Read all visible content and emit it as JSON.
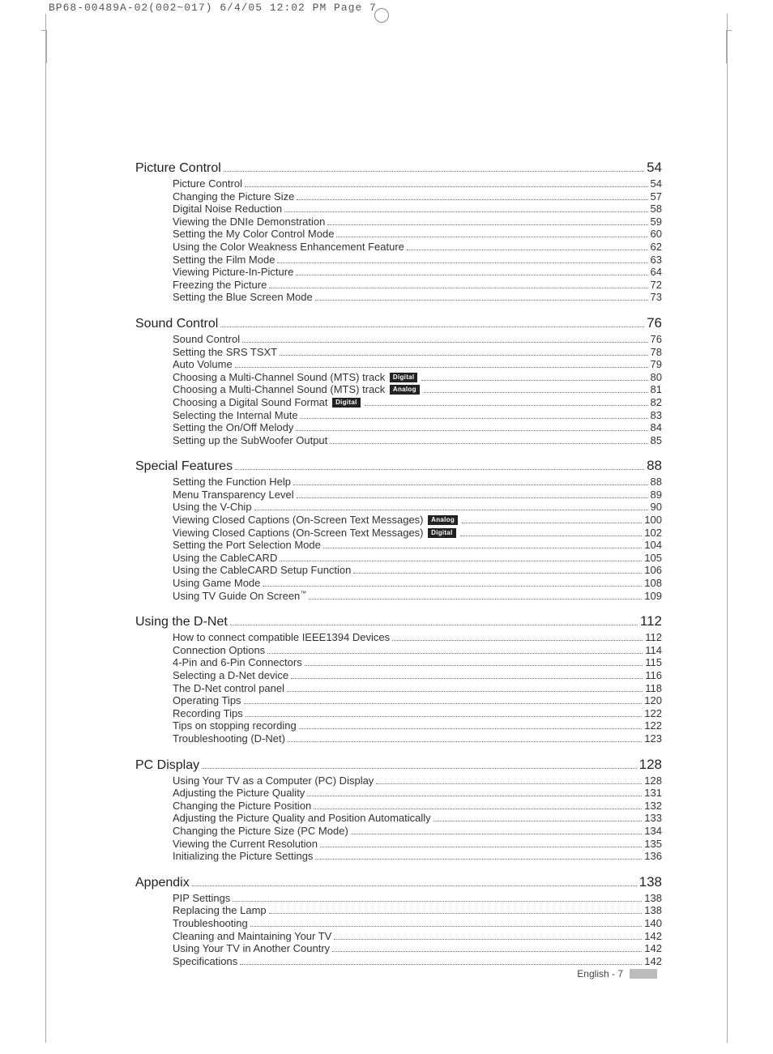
{
  "print_slug": "BP68-00489A-02(002~017)  6/4/05  12:02 PM  Page 7",
  "footer": "English - 7",
  "badges": {
    "digital": "Digital",
    "analog": "Analog"
  },
  "sections": [
    {
      "title": "Picture Control",
      "page": "54",
      "entries": [
        {
          "label": "Picture Control",
          "page": "54"
        },
        {
          "label": "Changing the Picture Size",
          "page": "57"
        },
        {
          "label": "Digital Noise Reduction",
          "page": "58"
        },
        {
          "label": "Viewing the DNIe Demonstration",
          "page": "59"
        },
        {
          "label": "Setting the My Color Control Mode",
          "page": "60"
        },
        {
          "label": "Using the Color Weakness Enhancement Feature",
          "page": "62"
        },
        {
          "label": "Setting the Film Mode",
          "page": "63"
        },
        {
          "label": "Viewing Picture-In-Picture",
          "page": "64"
        },
        {
          "label": "Freezing the Picture",
          "page": "72"
        },
        {
          "label": "Setting the Blue Screen Mode",
          "page": "73"
        }
      ]
    },
    {
      "title": "Sound Control",
      "page": "76",
      "entries": [
        {
          "label": "Sound Control",
          "page": "76"
        },
        {
          "label": "Setting the SRS TSXT",
          "page": "78"
        },
        {
          "label": "Auto Volume",
          "page": "79"
        },
        {
          "label": "Choosing a Multi-Channel Sound (MTS) track",
          "badge": "digital",
          "page": "80"
        },
        {
          "label": "Choosing a Multi-Channel Sound (MTS) track",
          "badge": "analog",
          "page": "81"
        },
        {
          "label": "Choosing a Digital Sound Format",
          "badge": "digital",
          "page": "82"
        },
        {
          "label": "Selecting the Internal Mute",
          "page": "83"
        },
        {
          "label": "Setting the On/Off Melody",
          "page": "84"
        },
        {
          "label": "Setting up the SubWoofer Output",
          "page": "85"
        }
      ]
    },
    {
      "title": "Special Features",
      "page": "88",
      "entries": [
        {
          "label": "Setting the Function Help",
          "page": "88"
        },
        {
          "label": "Menu Transparency Level",
          "page": "89"
        },
        {
          "label": "Using the V-Chip",
          "page": "90"
        },
        {
          "label": "Viewing Closed Captions (On-Screen Text Messages)",
          "badge": "analog",
          "page": "100"
        },
        {
          "label": "Viewing Closed Captions (On-Screen Text Messages)",
          "badge": "digital",
          "page": "102"
        },
        {
          "label": "Setting the Port Selection Mode",
          "page": "104"
        },
        {
          "label": "Using the CableCARD",
          "page": "105"
        },
        {
          "label": "Using the CableCARD Setup Function",
          "page": "106"
        },
        {
          "label": "Using Game Mode",
          "page": "108"
        },
        {
          "label": "Using TV Guide On Screen",
          "tm": true,
          "page": "109"
        }
      ]
    },
    {
      "title": "Using the D-Net",
      "page": "112",
      "entries": [
        {
          "label": "How to connect compatible IEEE1394 Devices",
          "page": "112"
        },
        {
          "label": "Connection Options",
          "page": "114"
        },
        {
          "label": "4-Pin and 6-Pin Connectors",
          "page": "115"
        },
        {
          "label": "Selecting a D-Net device",
          "page": "116"
        },
        {
          "label": "The D-Net control panel",
          "page": "118"
        },
        {
          "label": "Operating Tips",
          "page": "120"
        },
        {
          "label": "Recording Tips",
          "page": "122"
        },
        {
          "label": "Tips on stopping recording",
          "page": "122"
        },
        {
          "label": "Troubleshooting (D-Net)",
          "page": "123"
        }
      ]
    },
    {
      "title": "PC Display",
      "page": "128",
      "entries": [
        {
          "label": "Using Your TV as a Computer (PC) Display",
          "page": "128"
        },
        {
          "label": "Adjusting the Picture Quality",
          "page": "131"
        },
        {
          "label": "Changing the Picture Position",
          "page": "132"
        },
        {
          "label": "Adjusting the Picture Quality and Position Automatically",
          "page": "133"
        },
        {
          "label": "Changing the Picture Size (PC Mode)",
          "page": "134"
        },
        {
          "label": "Viewing the Current Resolution",
          "page": "135"
        },
        {
          "label": "Initializing the Picture Settings",
          "page": "136"
        }
      ]
    },
    {
      "title": "Appendix",
      "page": "138",
      "entries": [
        {
          "label": "PIP Settings",
          "page": "138"
        },
        {
          "label": "Replacing the Lamp",
          "page": "138"
        },
        {
          "label": "Troubleshooting",
          "page": "140"
        },
        {
          "label": "Cleaning and Maintaining Your TV",
          "page": "142"
        },
        {
          "label": "Using Your TV in Another Country",
          "page": "142"
        },
        {
          "label": "Specifications",
          "page": "142"
        }
      ]
    }
  ]
}
